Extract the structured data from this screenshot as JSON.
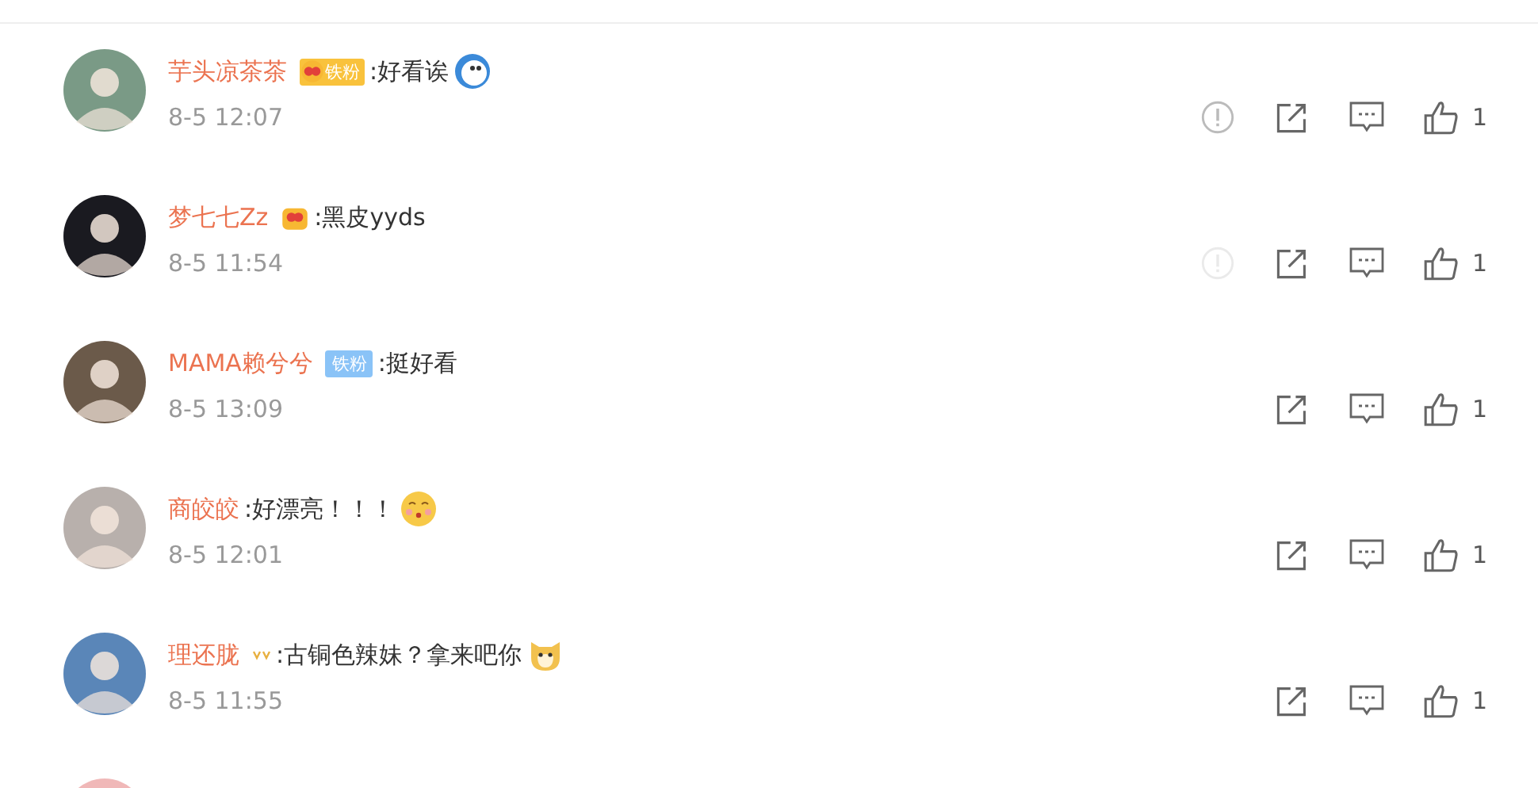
{
  "comments": [
    {
      "name": "芋头凉茶茶",
      "badge": {
        "kind": "crown_fan",
        "label": "铁粉"
      },
      "text": ":好看诶",
      "emoji": {
        "kind": "round_face"
      },
      "time": "8-5 12:07",
      "report": {
        "kind": "shown"
      },
      "likes": "1"
    },
    {
      "name": "梦七七Zz",
      "badge": {
        "kind": "crown"
      },
      "text": ":黑皮yyds",
      "time": "8-5 11:54",
      "report": {
        "kind": "faint"
      },
      "likes": "1"
    },
    {
      "name": "MAMA赖兮兮",
      "badge": {
        "kind": "fan",
        "label": "铁粉"
      },
      "text": ":挺好看",
      "time": "8-5 13:09",
      "likes": "1"
    },
    {
      "name": "商皎皎",
      "text": ":好漂亮！！！",
      "emoji": {
        "kind": "kiss"
      },
      "time": "8-5 12:01",
      "likes": "1"
    },
    {
      "name": "理还胧",
      "badge": {
        "kind": "v_mark"
      },
      "text": ":古铜色辣妹？拿来吧你",
      "emoji": {
        "kind": "dog"
      },
      "time": "8-5 11:55",
      "likes": "1"
    }
  ]
}
